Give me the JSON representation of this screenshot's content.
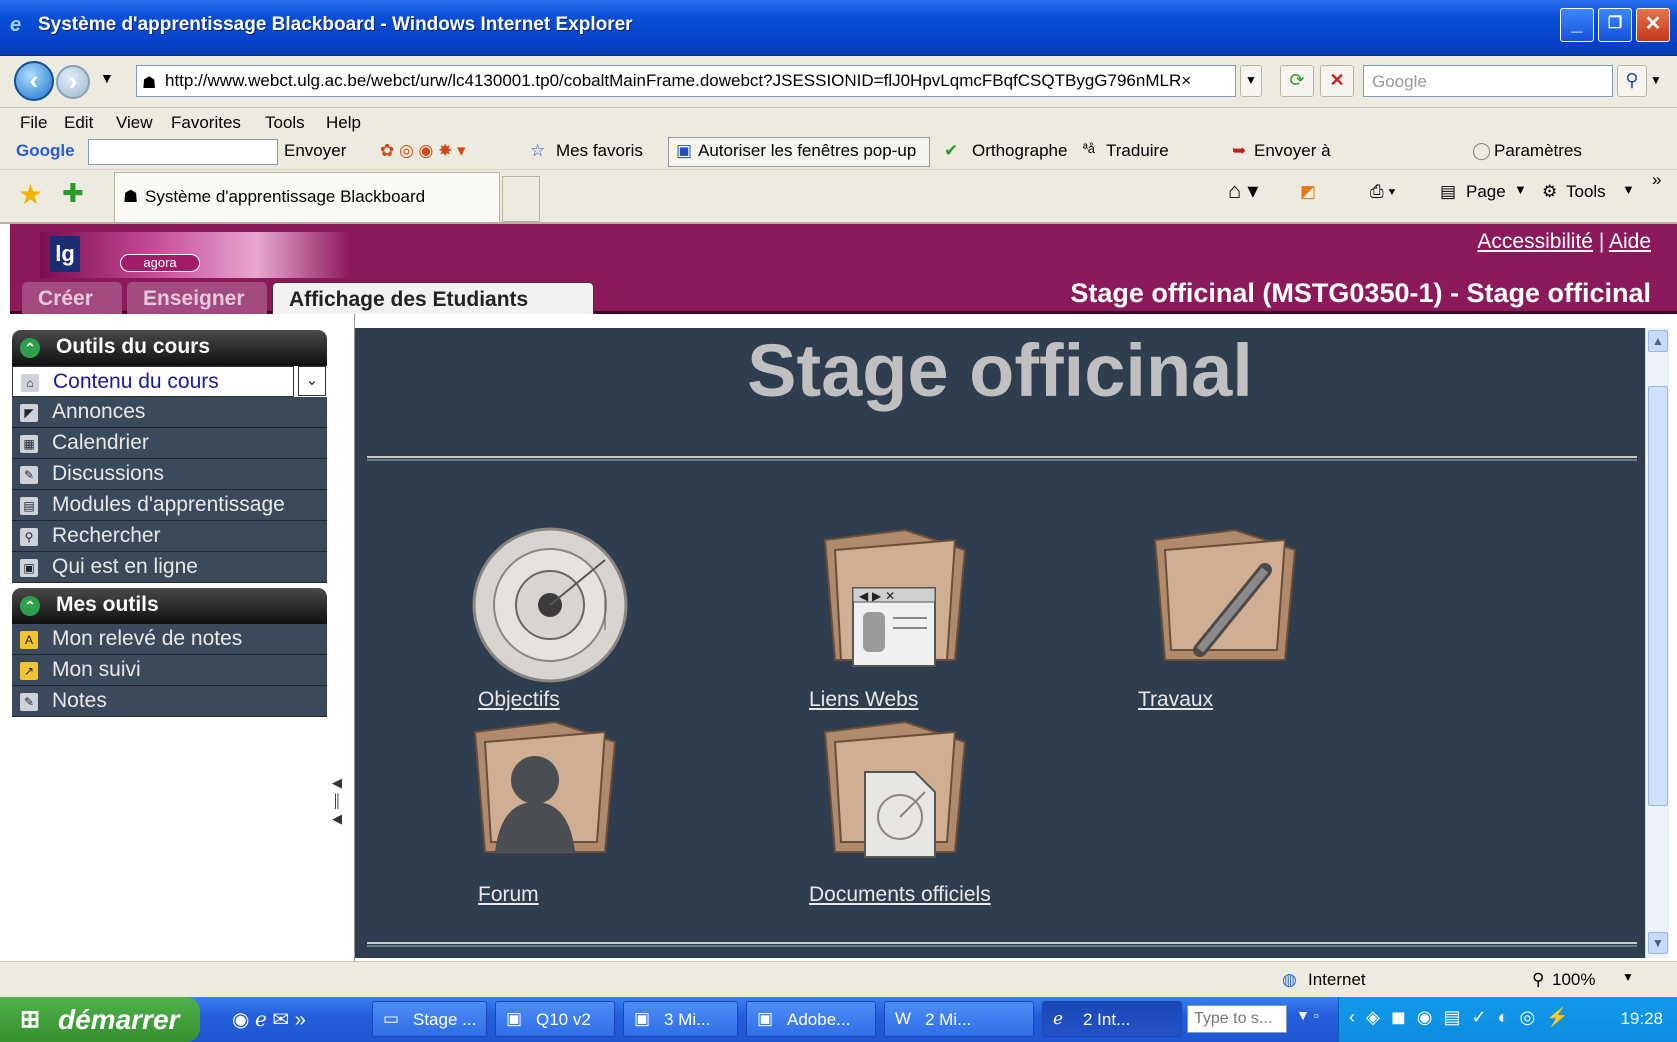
{
  "window": {
    "title": "Système d'apprentissage Blackboard - Windows Internet Explorer",
    "min": "_",
    "max": "❐",
    "close": "✕"
  },
  "address": {
    "url": "http://www.webct.ulg.ac.be/webct/urw/lc4130001.tp0/cobaltMainFrame.dowebct?JSESSIONID=flJ0HpvLqmcFBqfCSQTBygG796nMLR×",
    "search_placeholder": "Google"
  },
  "menu": [
    "File",
    "Edit",
    "View",
    "Favorites",
    "Tools",
    "Help"
  ],
  "google_toolbar": {
    "logo": "Google",
    "envoyer": "Envoyer",
    "favoris": "Mes favoris",
    "popup": "Autoriser les fenêtres pop-up",
    "ortho": "Orthographe",
    "traduire": "Traduire",
    "envoyer_a": "Envoyer à",
    "parametres": "Paramètres"
  },
  "tab": {
    "title": "Système d'apprentissage Blackboard"
  },
  "command_bar": {
    "page": "Page",
    "tools": "Tools"
  },
  "webct": {
    "accessibility": "Accessibilité",
    "separator": "|",
    "help": "Aide",
    "tabs": [
      "Créer",
      "Enseigner",
      "Affichage des Etudiants"
    ],
    "course": "Stage officinal (MSTG0350-1) - Stage officinal",
    "logo_text": "agora",
    "logo_lg": "lg"
  },
  "sidebar": {
    "section1": "Outils du cours",
    "items1": [
      "Contenu du cours",
      "Annonces",
      "Calendrier",
      "Discussions",
      "Modules d'apprentissage",
      "Rechercher",
      "Qui est en ligne"
    ],
    "section2": "Mes outils",
    "items2": [
      "Mon relevé de notes",
      "Mon suivi",
      "Notes"
    ]
  },
  "main": {
    "title": "Stage officinal",
    "links": [
      "Objectifs",
      "Liens Webs",
      "Travaux",
      "Forum",
      "Documents officiels"
    ]
  },
  "status": {
    "zone": "Internet",
    "zoom": "100%"
  },
  "taskbar": {
    "start": "démarrer",
    "buttons": [
      "Stage ...",
      "Q10 v2",
      "3 Mi...",
      "Adobe...",
      "2 Mi...",
      "2 Int..."
    ],
    "type_placeholder": "Type to s...",
    "clock": "19:28"
  }
}
